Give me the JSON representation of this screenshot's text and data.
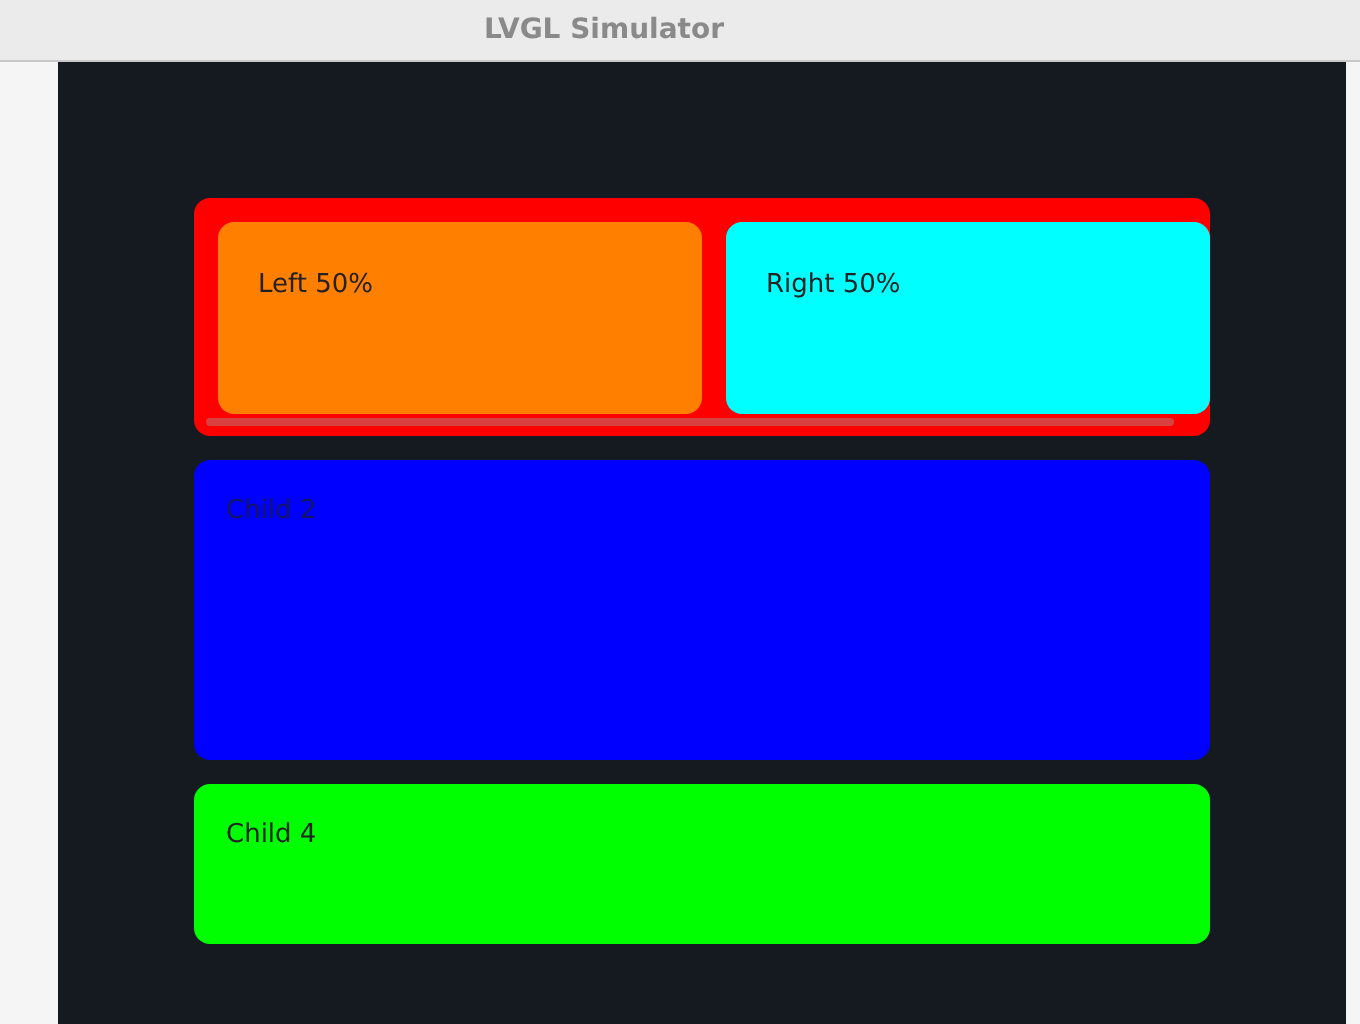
{
  "window": {
    "title": "LVGL Simulator"
  },
  "row": {
    "color": "#ff0000",
    "children": [
      {
        "label": "Left 50%",
        "color": "#ff7f00"
      },
      {
        "label": "Right 50%",
        "color": "#00ffff"
      }
    ]
  },
  "panels": [
    {
      "label": "Child 2",
      "color": "#0000ff"
    },
    {
      "label": "Child 4",
      "color": "#00ff00"
    }
  ]
}
